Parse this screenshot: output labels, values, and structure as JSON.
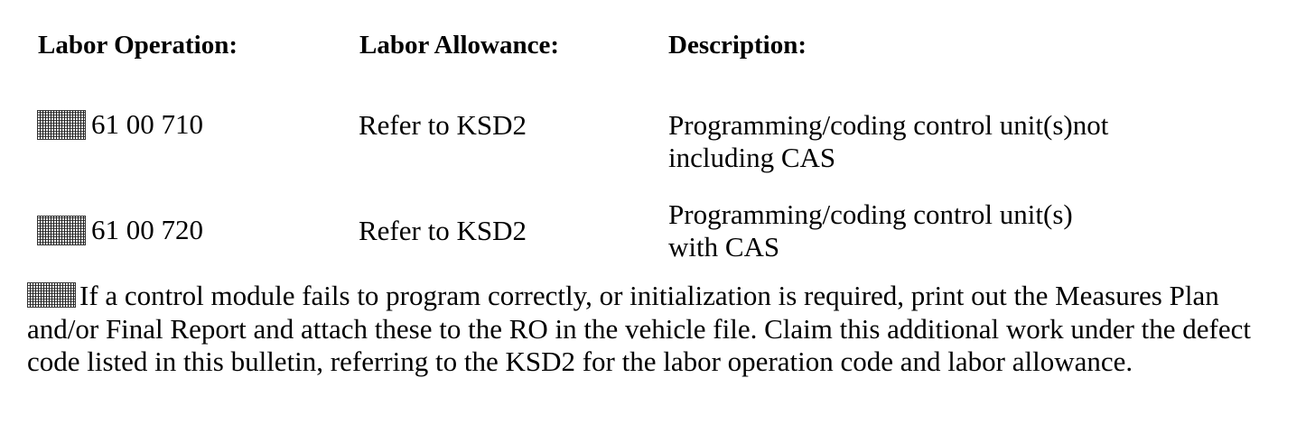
{
  "headers": {
    "labor_operation": "Labor Operation:",
    "labor_allowance": "Labor Allowance:",
    "description": "Description:"
  },
  "rows": [
    {
      "operation": "61 00 710",
      "allowance": "Refer to KSD2",
      "description_line1": "Programming/coding control unit(s)not",
      "description_line2": "including CAS"
    },
    {
      "operation": "61 00 720",
      "allowance": "Refer to KSD2",
      "description_line1": "Programming/coding control unit(s)",
      "description_line2": "with CAS"
    }
  ],
  "note": {
    "text": "If a control module fails to program correctly, or initialization is required, print out the Measures Plan and/or Final Report and attach these to the RO in the vehicle file. Claim this additional work under the defect code listed in this bulletin, referring to the KSD2 for the labor operation code and labor allowance."
  }
}
